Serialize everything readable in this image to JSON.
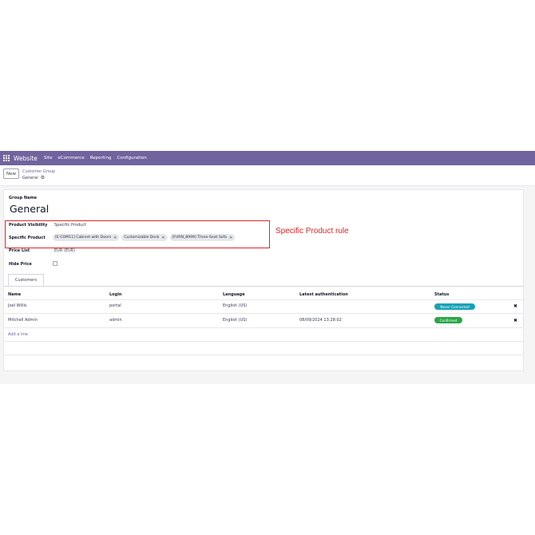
{
  "topbar": {
    "brand": "Website",
    "menu": [
      "Site",
      "eCommerce",
      "Reporting",
      "Configuration"
    ]
  },
  "controlbar": {
    "new_label": "New",
    "breadcrumb_parent": "Customer Group",
    "breadcrumb_current": "General"
  },
  "form": {
    "group_name_label": "Group Name",
    "group_name": "General",
    "product_visibility_label": "Product Visibility",
    "product_visibility_value": "Specific Product",
    "specific_product_label": "Specific Product",
    "specific_products": [
      "[E-COM11] Cabinet with Doors",
      "Customizable Desk",
      "[FURN_8999] Three-Seat Sofa"
    ],
    "price_list_label": "Price List",
    "price_list_value": "EUR (EUR)",
    "hide_price_label": "Hide Price",
    "hide_price_checked": false
  },
  "annotation": {
    "text": "Specific Product rule",
    "color": "#dc2626"
  },
  "tabs": [
    "Customers"
  ],
  "table": {
    "columns": [
      "Name",
      "Login",
      "Language",
      "Latest authentication",
      "Status"
    ],
    "rows": [
      {
        "name": "Joel Willis",
        "login": "portal",
        "language": "English (US)",
        "latest_auth": "",
        "status": "Never Connected",
        "status_color": "#17a2b8"
      },
      {
        "name": "Mitchell Admin",
        "login": "admin",
        "language": "English (US)",
        "latest_auth": "08/09/2024 13:28:02",
        "status": "Confirmed",
        "status_color": "#28a745"
      }
    ],
    "add_line": "Add a line"
  },
  "colors": {
    "topbar": "#71639e",
    "accent": "#71639e"
  }
}
